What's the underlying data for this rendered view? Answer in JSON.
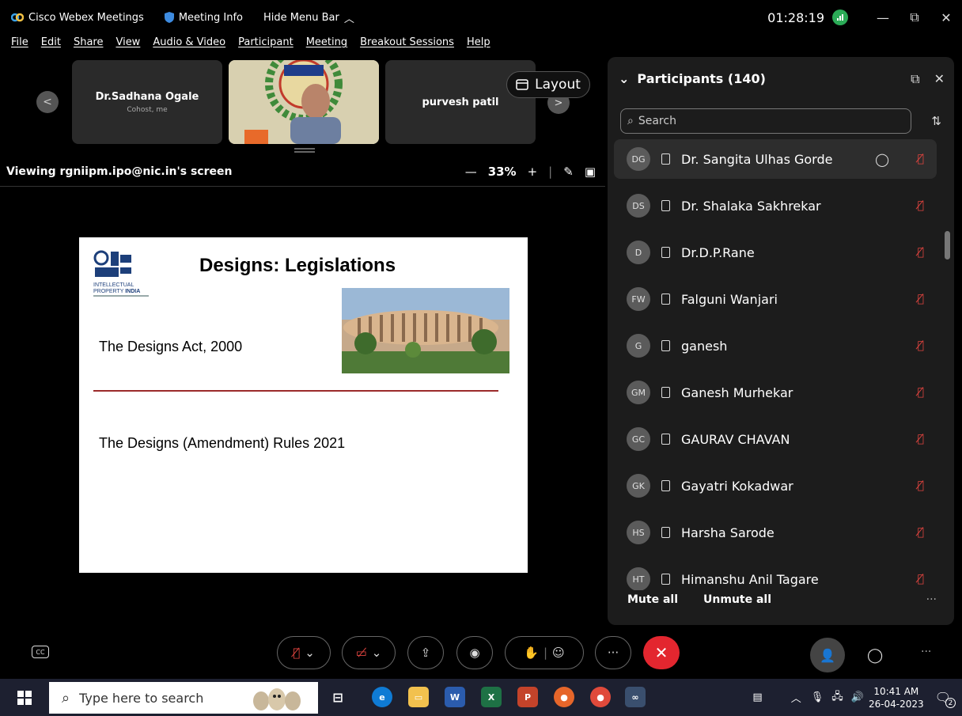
{
  "titlebar": {
    "app_name": "Cisco Webex Meetings",
    "meeting_info": "Meeting Info",
    "hide_menu": "Hide Menu Bar",
    "clock": "01:28:19"
  },
  "menu": [
    "File",
    "Edit",
    "Share",
    "View",
    "Audio & Video",
    "Participant",
    "Meeting",
    "Breakout Sessions",
    "Help"
  ],
  "strip": {
    "tiles": [
      {
        "name": "Dr.Sadhana Ogale",
        "sub": "Cohost, me"
      },
      {
        "name": "purvesh patil",
        "sub": ""
      }
    ],
    "layout_label": "Layout"
  },
  "viewing": {
    "label": "Viewing rgniipm.ipo@nic.in's screen",
    "zoom": "33%"
  },
  "slide": {
    "title": "Designs: Legislations",
    "logo_text": "INTELLECTUAL PROPERTY INDIA",
    "line1": "The Designs Act, 2000",
    "line2": "The Designs (Amendment) Rules 2021"
  },
  "participants": {
    "header": "Participants (140)",
    "search_placeholder": "Search",
    "list": [
      {
        "initials": "DG",
        "name": "Dr. Sangita Ulhas Gorde",
        "muted": true,
        "highlight": true
      },
      {
        "initials": "DS",
        "name": "Dr. Shalaka Sakhrekar",
        "muted": true
      },
      {
        "initials": "D",
        "name": "Dr.D.P.Rane",
        "muted": true
      },
      {
        "initials": "FW",
        "name": "Falguni Wanjari",
        "muted": true
      },
      {
        "initials": "G",
        "name": "ganesh",
        "muted": true
      },
      {
        "initials": "GM",
        "name": "Ganesh Murhekar",
        "muted": true
      },
      {
        "initials": "GC",
        "name": "GAURAV CHAVAN",
        "muted": true
      },
      {
        "initials": "GK",
        "name": "Gayatri Kokadwar",
        "muted": true
      },
      {
        "initials": "HS",
        "name": "Harsha Sarode",
        "muted": true
      },
      {
        "initials": "HT",
        "name": "Himanshu Anil Tagare",
        "muted": true
      }
    ],
    "mute_all": "Mute all",
    "unmute_all": "Unmute all"
  },
  "taskbar": {
    "search_placeholder": "Type here to search",
    "time": "10:41 AM",
    "date": "26-04-2023",
    "notif_count": "2"
  },
  "colors": {
    "end_call": "#e3262f",
    "muted_mic": "#e0443f",
    "recording": "#2bab57",
    "slide_rule": "#9b2a2a"
  }
}
